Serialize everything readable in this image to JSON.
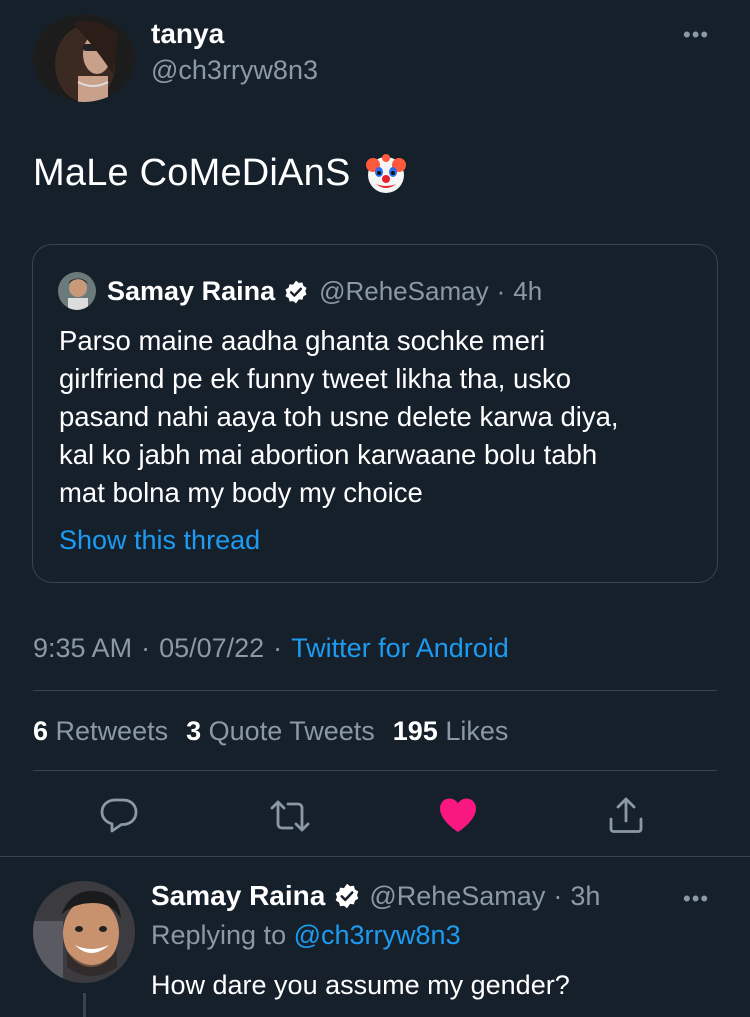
{
  "tweet": {
    "author_name": "tanya",
    "author_handle": "@ch3rryw8n3",
    "text": "MaLe CoMeDiAnS",
    "emoji": "clown-face-icon",
    "timestamp_time": "9:35 AM",
    "separator": "·",
    "timestamp_date": "05/07/22",
    "source": "Twitter for Android"
  },
  "quoted_tweet": {
    "author_name": "Samay Raina",
    "author_handle": "@ReheSamay",
    "time_ago": "4h",
    "text": "Parso maine aadha ghanta sochke meri\ngirlfriend pe ek funny tweet likha tha, usko\npasand nahi aaya toh usne delete karwa diya,\nkal ko jabh mai abortion karwaane bolu tabh\nmat bolna my body my choice",
    "show_thread": "Show this thread"
  },
  "stats": {
    "retweets_count": "6",
    "retweets_label": "Retweets",
    "quotes_count": "3",
    "quotes_label": "Quote Tweets",
    "likes_count": "195",
    "likes_label": "Likes"
  },
  "actions": {
    "reply_icon": "reply-icon",
    "retweet_icon": "retweet-icon",
    "like_icon": "heart-icon",
    "share_icon": "share-icon",
    "liked": true
  },
  "reply": {
    "author_name": "Samay Raina",
    "author_handle": "@ReheSamay",
    "time_ago": "3h",
    "replying_to_label": "Replying to",
    "replying_to_handle": "@ch3rryw8n3",
    "text": "How dare you assume my gender?"
  },
  "colors": {
    "background": "#15202b",
    "accent": "#1d9bf0",
    "muted": "#8b98a5",
    "like": "#f91880",
    "border": "#38444d"
  }
}
